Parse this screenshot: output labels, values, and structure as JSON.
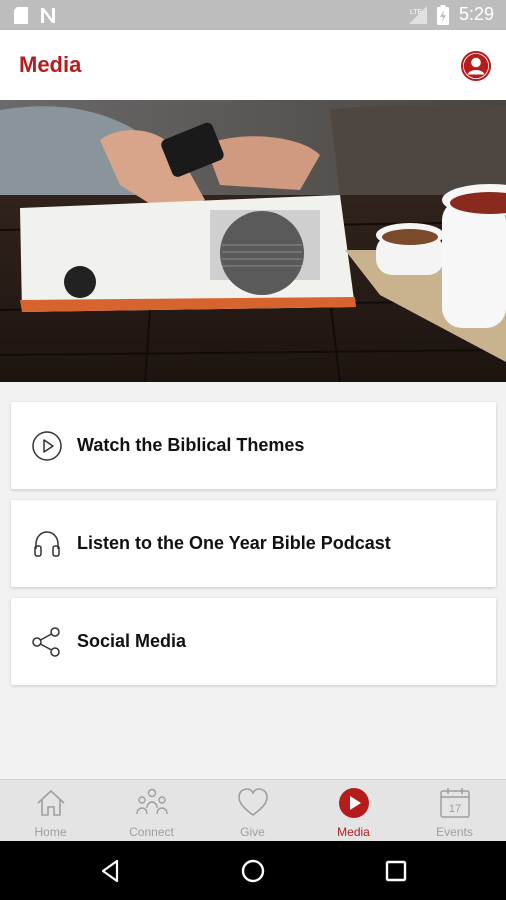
{
  "status_bar": {
    "time": "5:29",
    "icons": [
      "sim-card-icon",
      "n-notification-icon",
      "signal-icon",
      "battery-icon"
    ]
  },
  "app_bar": {
    "title": "Media",
    "profile_icon": "account-circle-icon",
    "accent_color": "#b71c1c"
  },
  "hero": {
    "image": "person-holding-phone-with-magazine-and-coffee"
  },
  "media_items": [
    {
      "label": "Watch the Biblical Themes",
      "icon": "play-circle-icon"
    },
    {
      "label": "Listen to the One Year Bible Podcast",
      "icon": "headphones-icon"
    },
    {
      "label": "Social Media",
      "icon": "share-icon"
    }
  ],
  "bottom_nav": {
    "active": "Media",
    "items": [
      {
        "label": "Home",
        "icon": "home-icon"
      },
      {
        "label": "Connect",
        "icon": "people-icon"
      },
      {
        "label": "Give",
        "icon": "heart-icon"
      },
      {
        "label": "Media",
        "icon": "play-circle-filled-icon"
      },
      {
        "label": "Events",
        "icon": "calendar-icon",
        "date": "17"
      }
    ]
  },
  "system_nav": [
    "back-icon",
    "home-circle-icon",
    "recents-icon"
  ]
}
